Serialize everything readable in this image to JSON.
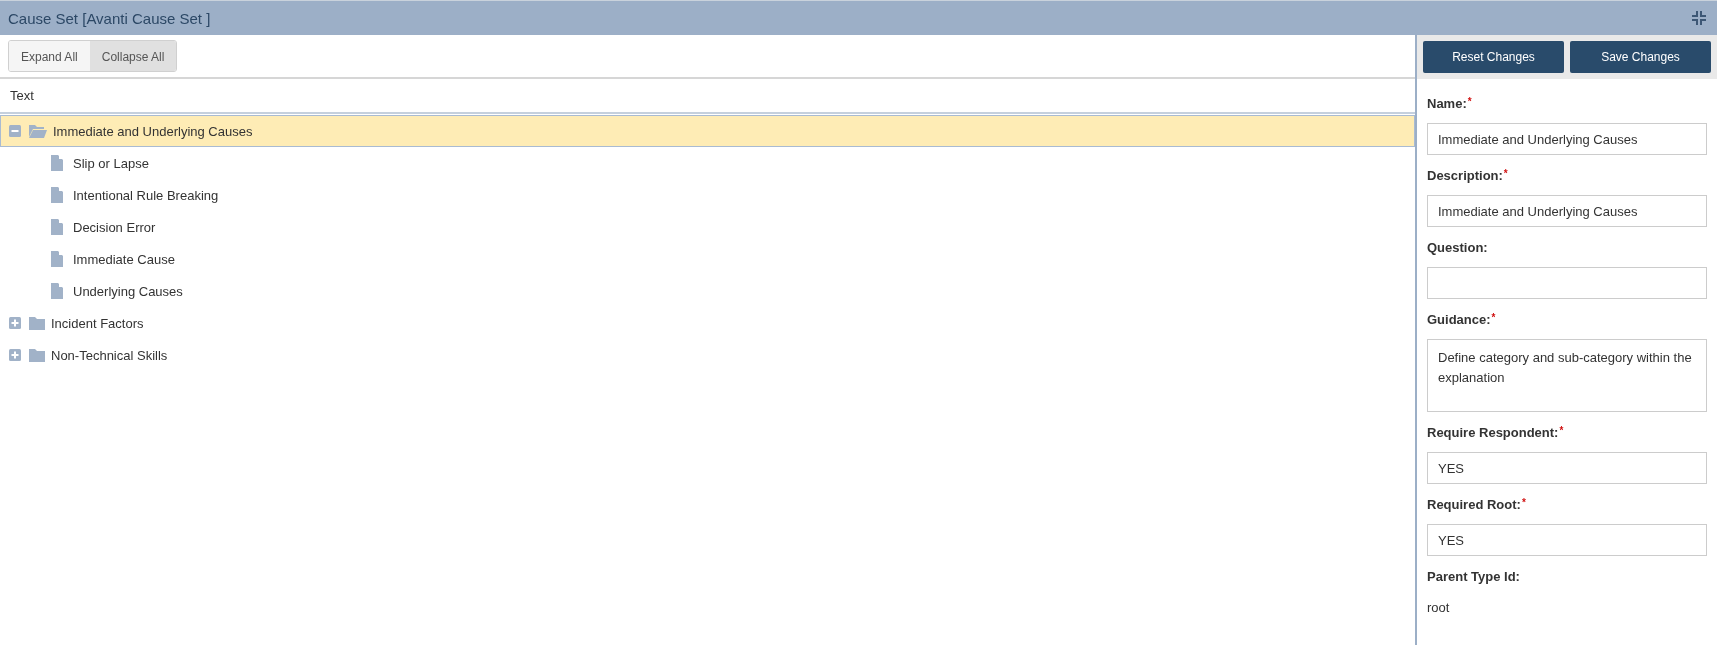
{
  "window": {
    "title": "Cause Set [Avanti Cause Set ]"
  },
  "toolbar": {
    "buttons": [
      {
        "label": "Expand All",
        "selected": false
      },
      {
        "label": "Collapse All",
        "selected": true
      }
    ]
  },
  "tree": {
    "column": "Text",
    "nodes": [
      {
        "label": "Immediate and Underlying Causes",
        "kind": "folder",
        "expanded": true,
        "selected": true,
        "children": [
          {
            "label": "Slip or Lapse",
            "kind": "document",
            "selected": false
          },
          {
            "label": "Intentional Rule Breaking",
            "kind": "document",
            "selected": false
          },
          {
            "label": "Decision Error",
            "kind": "document",
            "selected": false
          },
          {
            "label": "Immediate Cause",
            "kind": "document",
            "selected": false
          },
          {
            "label": "Underlying Causes",
            "kind": "document",
            "selected": false
          }
        ]
      },
      {
        "label": "Incident Factors",
        "kind": "folder",
        "expanded": false,
        "selected": false
      },
      {
        "label": "Non-Technical Skills",
        "kind": "folder",
        "expanded": false,
        "selected": false
      }
    ]
  },
  "details": {
    "buttons": [
      "Reset Changes",
      "Save Changes"
    ],
    "fields": [
      {
        "label": "Name:",
        "required_mark": "*",
        "kind": "input",
        "value": "Immediate and Underlying Causes"
      },
      {
        "label": "Description:",
        "required_mark": "*",
        "kind": "input",
        "value": "Immediate and Underlying Causes"
      },
      {
        "label": "Question:",
        "kind": "input"
      },
      {
        "label": "Guidance:",
        "required_mark": "*",
        "kind": "textarea",
        "value": "Define category and sub-category within the explanation"
      },
      {
        "label": "Require Respondent:",
        "required_mark": "*",
        "kind": "input",
        "value": "YES"
      },
      {
        "label": "Required Root:",
        "required_mark": "*",
        "kind": "input",
        "value": "YES"
      },
      {
        "label": "Parent Type Id:",
        "kind": "static",
        "value": "root"
      }
    ]
  }
}
